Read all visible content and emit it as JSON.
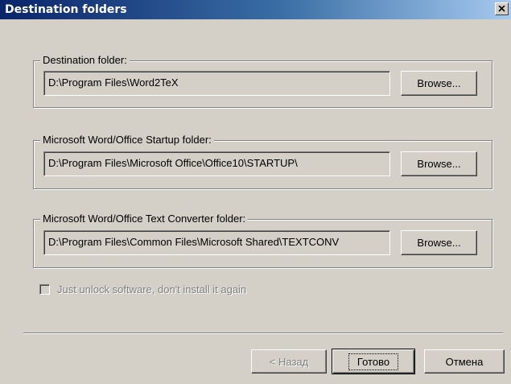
{
  "window": {
    "title": "Destination folders",
    "close_icon": "close-icon"
  },
  "groups": [
    {
      "label": "Destination folder:",
      "path": "D:\\Program Files\\Word2TeX",
      "browse_label": "Browse..."
    },
    {
      "label": "Microsoft Word/Office Startup folder:",
      "path": "D:\\Program Files\\Microsoft Office\\Office10\\STARTUP\\",
      "browse_label": "Browse..."
    },
    {
      "label": "Microsoft Word/Office Text Converter folder:",
      "path": "D:\\Program Files\\Common Files\\Microsoft Shared\\TEXTCONV",
      "browse_label": "Browse..."
    }
  ],
  "checkbox": {
    "label": "Just unlock software, don't install it again",
    "checked": false,
    "disabled": true
  },
  "footer": {
    "back_label": "< Назад",
    "finish_label": "Готово",
    "cancel_label": "Отмена"
  },
  "colors": {
    "face": "#d4d0c8",
    "title_start": "#0a246a",
    "title_end": "#a6caf0",
    "disabled_text": "#808080"
  }
}
